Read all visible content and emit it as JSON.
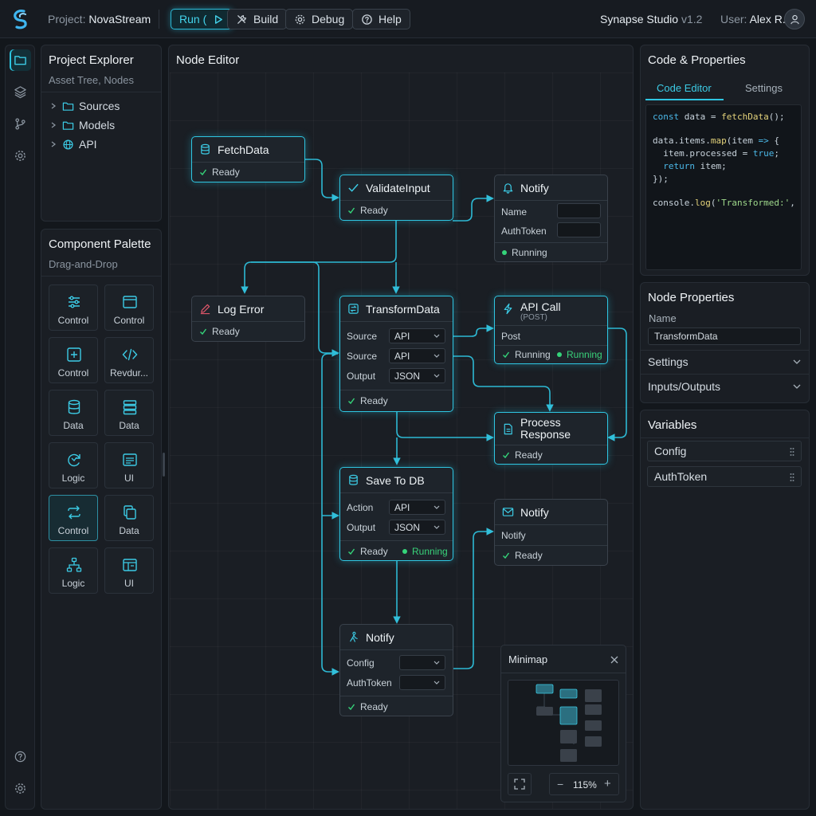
{
  "header": {
    "project_label": "Project:",
    "project_name": "NovaStream",
    "buttons": {
      "run": "Run (",
      "build": "Build",
      "debug": "Debug",
      "help": "Help"
    },
    "app_name": "Synapse Studio",
    "version": "v1.2",
    "user_label": "User:",
    "user_name": "Alex R."
  },
  "explorer": {
    "title": "Project Explorer",
    "subtitle": "Asset Tree, Nodes",
    "items": [
      "Sources",
      "Models",
      "API"
    ]
  },
  "palette": {
    "title": "Component Palette",
    "subtitle": "Drag-and-Drop",
    "tiles": [
      "Control",
      "Control",
      "Control",
      "Revdur...",
      "Data",
      "Data",
      "Logic",
      "UI",
      "Control",
      "Data",
      "Logic",
      "UI"
    ]
  },
  "editor": {
    "title": "Node Editor",
    "nodes": {
      "fetch": {
        "title": "FetchData",
        "status": "Ready"
      },
      "validate": {
        "title": "ValidateInput",
        "status": "Ready"
      },
      "notify1": {
        "title": "Notify",
        "field1": "Name",
        "field2": "AuthToken",
        "status": "Running"
      },
      "log": {
        "title": "Log Error",
        "status": "Ready"
      },
      "transform": {
        "title": "TransformData",
        "rows": [
          {
            "label": "Source",
            "value": "API"
          },
          {
            "label": "Source",
            "value": "API"
          },
          {
            "label": "Output",
            "value": "JSON"
          }
        ],
        "status": "Ready"
      },
      "api": {
        "title": "API Call",
        "subtitle": "(POST)",
        "field": "Post",
        "status": "Running",
        "status2": "Running"
      },
      "process": {
        "title_line1": "Process",
        "title_line2": "Response",
        "status": "Ready"
      },
      "save": {
        "title": "Save To DB",
        "rows": [
          {
            "label": "Action",
            "value": "API"
          },
          {
            "label": "Output",
            "value": "JSON"
          }
        ],
        "status": "Ready",
        "status2": "Running"
      },
      "notify2": {
        "title": "Notify",
        "field": "Notify",
        "status": "Ready"
      },
      "notify3": {
        "title": "Notify",
        "field1": "Config",
        "field2": "AuthToken",
        "status": "Ready"
      }
    },
    "minimap": {
      "title": "Minimap",
      "zoom": "115%",
      "minus": "−",
      "plus": "+"
    }
  },
  "code_panel": {
    "title": "Code & Properties",
    "tabs": [
      "Code Editor",
      "Settings"
    ],
    "active_tab": "Code Editor"
  },
  "properties": {
    "title": "Node Properties",
    "name_label": "Name",
    "name_value": "TransformData",
    "sections": [
      "Settings",
      "Inputs/Outputs"
    ]
  },
  "variables": {
    "title": "Variables",
    "items": [
      "Config",
      "AuthToken"
    ]
  },
  "colors": {
    "accent": "#2fc6e2",
    "running": "#35d47a",
    "background": "#13171c"
  }
}
